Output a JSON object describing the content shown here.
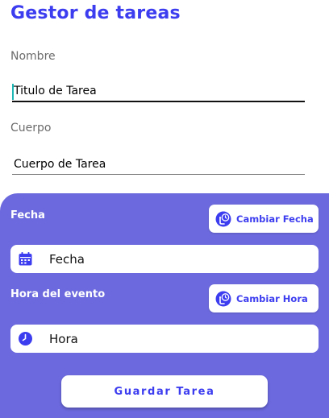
{
  "app": {
    "title": "Gestor de tareas"
  },
  "form": {
    "nombre_label": "Nombre",
    "nombre_value": "Titulo de Tarea",
    "cuerpo_label": "Cuerpo",
    "cuerpo_value": "Cuerpo de Tarea"
  },
  "schedule": {
    "fecha_label": "Fecha",
    "cambiar_fecha_label": "Cambiar Fecha",
    "fecha_value": "Fecha",
    "hora_label": "Hora del evento",
    "cambiar_hora_label": "Cambiar Hora",
    "hora_value": "Hora"
  },
  "actions": {
    "guardar_label": "Guardar Tarea"
  },
  "icons": {
    "cambiar_fecha": "touch-clock-icon",
    "cambiar_hora": "touch-clock-icon",
    "fecha": "calendar-icon",
    "hora": "clock-icon"
  },
  "colors": {
    "accent": "#3d3df0",
    "panel": "#6b69dd",
    "caret": "#1fb6b6"
  }
}
